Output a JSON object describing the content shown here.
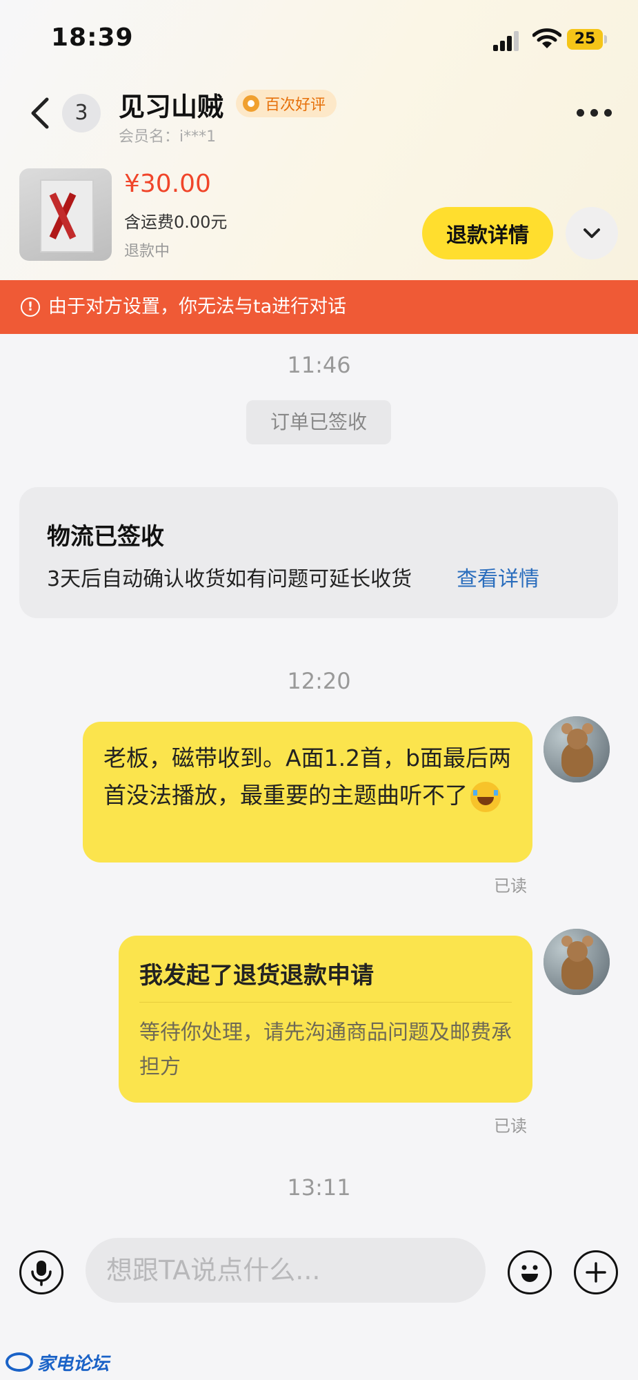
{
  "status_bar": {
    "time": "18:39",
    "battery": "25"
  },
  "header": {
    "unread_count": "3",
    "seller_name": "见习山贼",
    "reputation_badge": "百次好评",
    "member_name": "会员名：i***1"
  },
  "order": {
    "price": "¥30.00",
    "shipping": "含运费0.00元",
    "status": "退款中",
    "refund_button": "退款详情"
  },
  "banner": {
    "text": "由于对方设置，你无法与ta进行对话"
  },
  "chat": {
    "timestamps": [
      "11:46",
      "12:20",
      "13:11"
    ],
    "system_notice": "订单已签收",
    "logistics_card": {
      "title": "物流已签收",
      "description": "3天后自动确认收货如有问题可延长收货",
      "link": "查看详情"
    },
    "messages": [
      {
        "text": "老板，磁带收到。A面1.2首，b面最后两首没法播放，最重要的主题曲听不了",
        "emoji": "crying-laughing-emoji",
        "status": "已读"
      },
      {
        "title": "我发起了退货退款申请",
        "text": "等待你处理，请先沟通商品问题及邮费承担方",
        "status": "已读"
      }
    ]
  },
  "input": {
    "placeholder": "想跟TA说点什么..."
  },
  "watermark": {
    "text": "家电论坛"
  },
  "colors": {
    "accent": "#ffde2e",
    "banner": "#ef5a36",
    "price": "#f0452a",
    "link": "#2a6dbd",
    "bubble": "#fbe44d"
  }
}
